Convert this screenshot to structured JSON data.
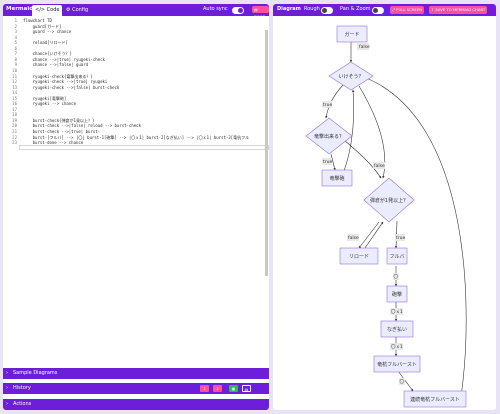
{
  "editor_panel": {
    "brand": "Mermaid",
    "tabs": [
      {
        "label": "</> Code"
      },
      {
        "label": "Config"
      }
    ],
    "autosync_label": "Auto sync",
    "docs_label": "DOCS",
    "lines": [
      "flowchart TD",
      "    guard[ガード]",
      "    guard --> chance",
      "",
      "    reload[リロード]",
      "",
      "    chance{いけそう？}",
      "    chance -->|true| ryugeki-check",
      "    chance -->|false| guard",
      "",
      "    ryugeki-check{竜撃出来る？}",
      "    ryugeki-check -->|true| ryugeki",
      "    ryugeki-check -->|false| burst-check",
      "",
      "    ryugeki[竜撃砲]",
      "    ryugeki --> chance",
      "",
      "",
      "    burst-check{弾倉が1発以上？}",
      "    burst-check -->|false| reload --> burst-check",
      "    burst-check -->|true| burst-",
      "    burst-[フルバ] --> |〇| burst-1[砲撃] --> |〇ｘ1| burst-2[なぎ払い] --> |〇ｘ1| burst-3[竜杭フル",
      "    burst-done --> chance"
    ],
    "sections": [
      {
        "label": "Sample Diagrams"
      },
      {
        "label": "History"
      },
      {
        "label": "Actions"
      }
    ],
    "history_buttons": [
      "⇩",
      "⇩",
      "▣",
      "▤"
    ]
  },
  "diagram_panel": {
    "title": "Diagram",
    "rough_label": "Rough",
    "panzoom_label": "Pan & Zoom",
    "fullscreen_label": "FULL SCREEN",
    "save_label": "SAVE TO MERMAID CHART",
    "nodes": {
      "guard": "ガード",
      "chance": "いけそう？",
      "ryugeki_check": "竜撃出来る？",
      "ryugeki": "竜撃砲",
      "burst_check": "弾倉が1発以上？",
      "reload": "リロード",
      "fullba": "フルバ",
      "hougeki": "砲撃",
      "nagiharai": "なぎ払い",
      "ryukui": "竜杭フルバースト",
      "done": "連続竜杭フルバースト"
    },
    "edge_labels": {
      "chance_false": "false",
      "chance_true": "true",
      "rc_true": "true",
      "rc_false": "false",
      "bc_false": "false",
      "bc_true": "true",
      "e1": "〇",
      "e2": "〇ｘ1",
      "e3": "〇ｘ1",
      "e4": "〇"
    }
  },
  "colors": {
    "accent": "#6d1ed9",
    "pink": "#ff4fa0",
    "node_fill": "#ececff",
    "node_stroke": "#9370db"
  }
}
